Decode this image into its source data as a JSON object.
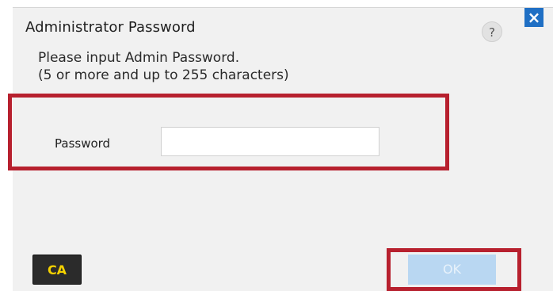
{
  "dialog": {
    "title": "Administrator Password",
    "help_label": "?",
    "close_label": "×",
    "instruction_line1": "Please input Admin Password.",
    "instruction_line2": "(5 or more and up to 255 characters)"
  },
  "form": {
    "password_label": "Password",
    "password_value": "",
    "password_placeholder": ""
  },
  "footer": {
    "ca_label": "CA",
    "ok_label": "OK"
  },
  "colors": {
    "dialog_background": "#f1f1f1",
    "highlight": "#b7202e",
    "close_button": "#1f6fc4",
    "ok_button_disabled": "#b9d7f2",
    "ca_text": "#f4d100"
  }
}
